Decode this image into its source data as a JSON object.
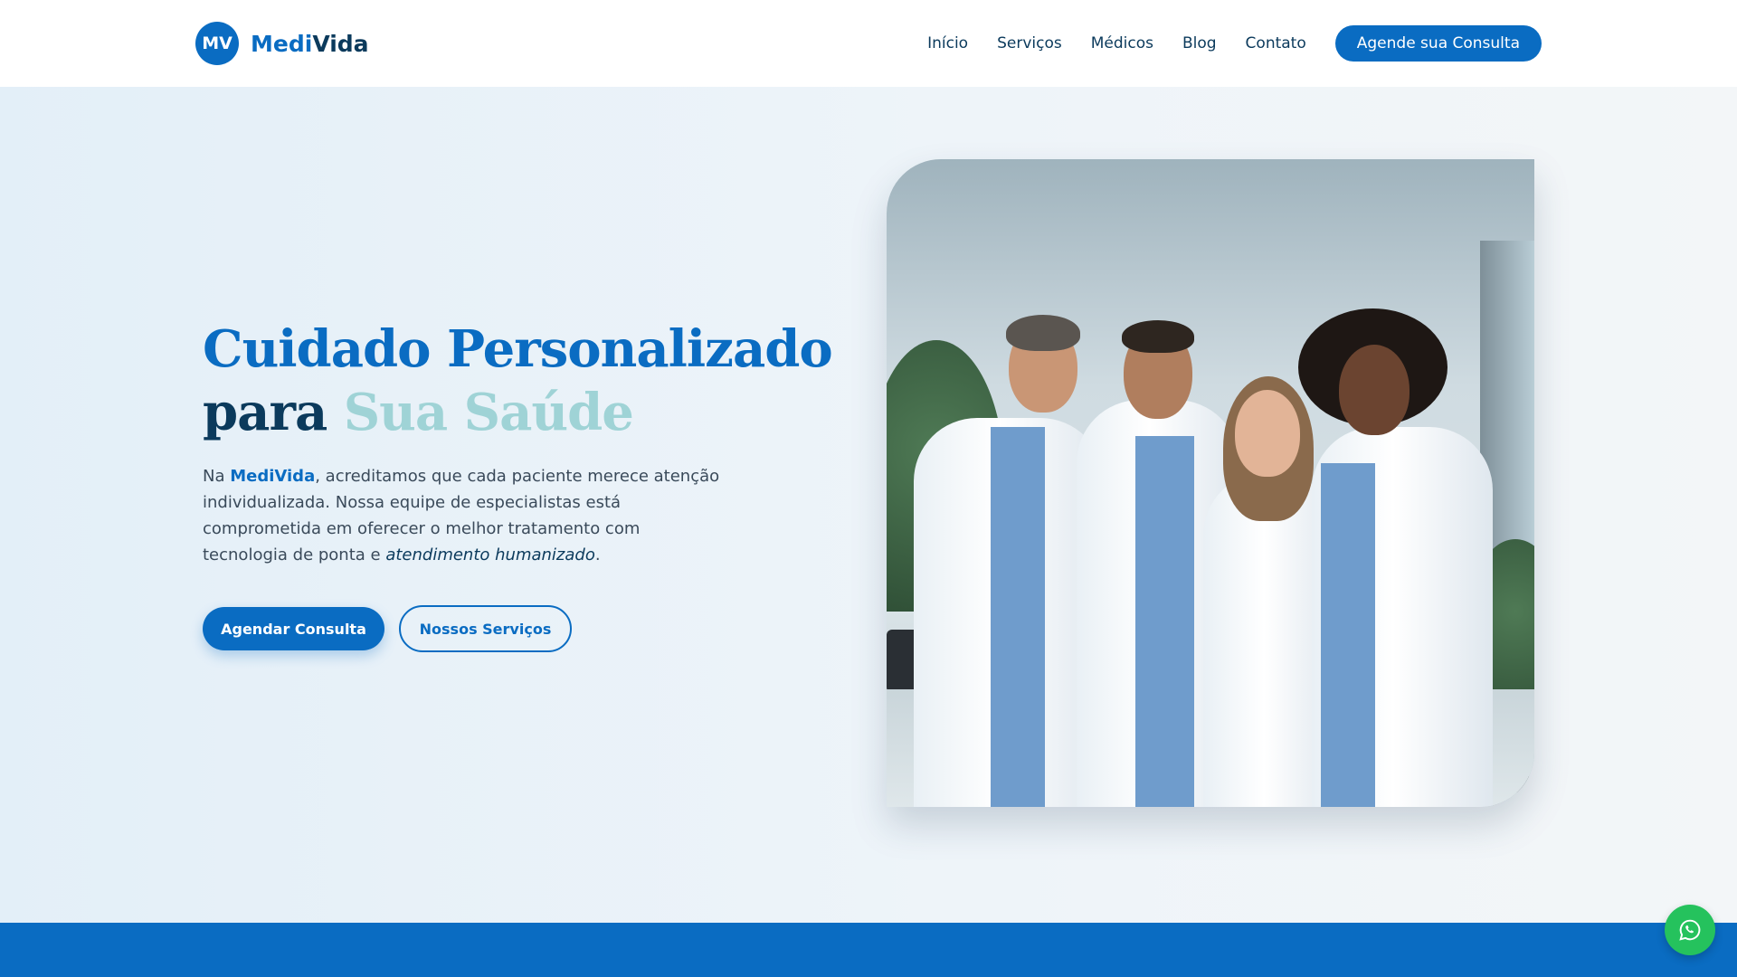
{
  "brand": {
    "badge": "MV",
    "name_part1": "Medi",
    "name_part2": "Vida"
  },
  "nav": {
    "items": [
      "Início",
      "Serviços",
      "Médicos",
      "Blog",
      "Contato"
    ],
    "cta": "Agende sua Consulta"
  },
  "hero": {
    "title_line1": "Cuidado Personalizado",
    "title_line2_a": "para ",
    "title_line2_b": "Sua Saúde",
    "desc_intro": "Na ",
    "desc_brand": "MediVida",
    "desc_body": ", acreditamos que cada paciente merece atenção individualizada. Nossa equipe de especialistas está comprometida em oferecer o melhor tratamento com tecnologia de ponta e ",
    "desc_emph": "atendimento humanizado",
    "desc_end": ".",
    "primary_button": "Agendar Consulta",
    "secondary_button": "Nossos Serviços"
  },
  "colors": {
    "primary": "#0a6cc2",
    "dark": "#0b3a5c",
    "accent": "#9fd3d6",
    "whatsapp": "#25c25d"
  },
  "icons": {
    "floating": "whatsapp-icon"
  }
}
